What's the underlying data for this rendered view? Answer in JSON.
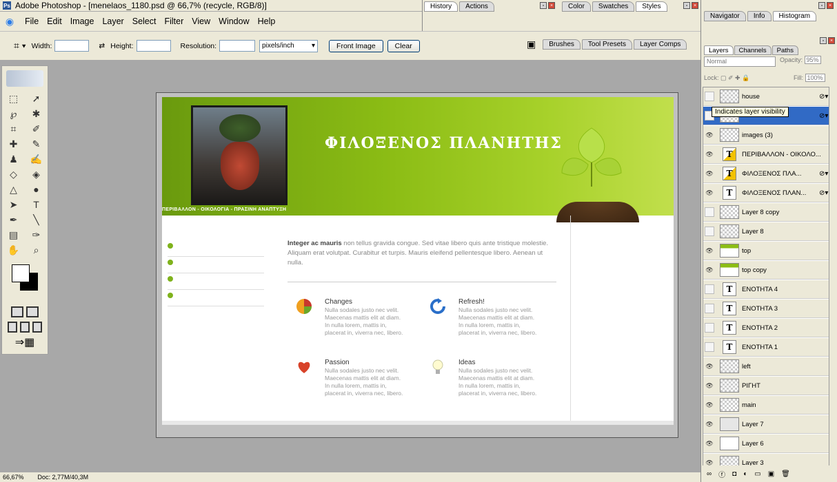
{
  "window": {
    "title": "Adobe Photoshop - [menelaos_1180.psd @ 66,7% (recycle, RGB/8)]"
  },
  "menu": [
    "File",
    "Edit",
    "Image",
    "Layer",
    "Select",
    "Filter",
    "View",
    "Window",
    "Help"
  ],
  "options": {
    "width_label": "Width:",
    "height_label": "Height:",
    "resolution_label": "Resolution:",
    "units": "pixels/inch",
    "front_image": "Front Image",
    "clear": "Clear"
  },
  "palette_well": {
    "row1": [
      "History",
      "Actions"
    ],
    "row2": [
      "Brushes",
      "Tool Presets",
      "Layer Comps"
    ],
    "color_tabs": [
      "Color",
      "Swatches",
      "Styles"
    ],
    "nav_tabs": [
      "Navigator",
      "Info",
      "Histogram"
    ]
  },
  "document": {
    "title": "ΦΙΛΟΞΕΝΟΣ ΠΛΑΝΗΤΗΣ",
    "subtitle": "ΠΕΡΙΒΑΛΛΟΝ - ΟΙΚΟΛΟΓΙΑ - ΠΡΑΣΙΝΗ ΑΝΑΠΤΥΞΗ",
    "intro_bold": "Integer ac mauris",
    "intro_text": " non tellus gravida congue. Sed vitae libero quis ante tristique molestie. Aliquam erat volutpat. Curabitur et turpis. Mauris eleifend pellentesque libero. Aenean ut nulla.",
    "features": [
      {
        "title": "Changes",
        "text": "Nulla sodales justo nec velit. Maecenas mattis elit at diam. In nulla lorem, mattis in, placerat in, viverra nec, libero.",
        "icon": "pie-chart-icon"
      },
      {
        "title": "Refresh!",
        "text": "Nulla sodales justo nec velit. Maecenas mattis elit at diam. In nulla lorem, mattis in, placerat in, viverra nec, libero.",
        "icon": "refresh-icon"
      },
      {
        "title": "Passion",
        "text": "Nulla sodales justo nec velit. Maecenas mattis elit at diam. In nulla lorem, mattis in, placerat in, viverra nec, libero.",
        "icon": "heart-icon"
      },
      {
        "title": "Ideas",
        "text": "Nulla sodales justo nec velit. Maecenas mattis elit at diam. In nulla lorem, mattis in, placerat in, viverra nec, libero.",
        "icon": "lightbulb-icon"
      }
    ]
  },
  "layers_panel": {
    "tabs": [
      "Layers",
      "Channels",
      "Paths"
    ],
    "blend_mode": "Normal",
    "opacity_label": "Opacity:",
    "opacity": "95%",
    "lock_label": "Lock:",
    "fill_label": "Fill:",
    "fill": "100%",
    "tooltip": "Indicates layer visibility",
    "layers": [
      {
        "name": "house",
        "visible": false,
        "kind": "pixel",
        "fx": true
      },
      {
        "name": "",
        "visible": false,
        "kind": "pixel",
        "fx": true,
        "selected": true
      },
      {
        "name": "images (3)",
        "visible": true,
        "kind": "pixel"
      },
      {
        "name": "ΠΕΡΙΒΑΛΛΟΝ - ΟΙΚΟΛΟ...",
        "visible": true,
        "kind": "text-warn"
      },
      {
        "name": "ΦΙΛΟΞΕΝΟΣ ΠΛΑ...",
        "visible": true,
        "kind": "text-warn",
        "fx": true
      },
      {
        "name": "ΦΙΛΟΞΕΝΟΣ ΠΛΑΝ...",
        "visible": true,
        "kind": "text",
        "fx": true
      },
      {
        "name": "Layer 8 copy",
        "visible": false,
        "kind": "pixel"
      },
      {
        "name": "Layer 8",
        "visible": false,
        "kind": "pixel"
      },
      {
        "name": "top",
        "visible": true,
        "kind": "green"
      },
      {
        "name": "top copy",
        "visible": true,
        "kind": "green"
      },
      {
        "name": "ΕΝΟΤΗΤΑ 4",
        "visible": false,
        "kind": "text"
      },
      {
        "name": "ΕΝΟΤΗΤΑ 3",
        "visible": false,
        "kind": "text"
      },
      {
        "name": "ΕΝΟΤΗΤΑ 2",
        "visible": false,
        "kind": "text"
      },
      {
        "name": "ΕΝΟΤΗΤΑ 1",
        "visible": false,
        "kind": "text"
      },
      {
        "name": "left",
        "visible": true,
        "kind": "pixel"
      },
      {
        "name": "ΡΙΓΗΤ",
        "visible": true,
        "kind": "pixel"
      },
      {
        "name": "main",
        "visible": true,
        "kind": "pixel"
      },
      {
        "name": "Layer 7",
        "visible": true,
        "kind": "gray"
      },
      {
        "name": "Layer 6",
        "visible": true,
        "kind": "white"
      },
      {
        "name": "Layer 3",
        "visible": true,
        "kind": "pixel"
      }
    ]
  },
  "status": {
    "zoom": "66,67%",
    "doc": "Doc: 2,77M/40,3M"
  }
}
